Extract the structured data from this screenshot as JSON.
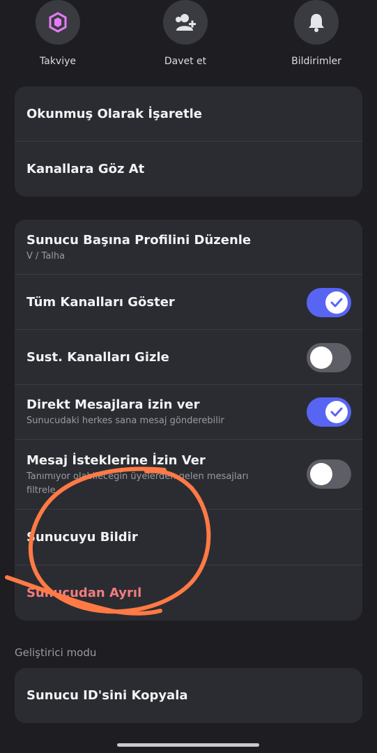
{
  "quick_actions": [
    {
      "label": "Takviye",
      "icon": "boost-icon",
      "icon_color": "#e67bf5"
    },
    {
      "label": "Davet et",
      "icon": "invite-user-icon"
    },
    {
      "label": "Bildirimler",
      "icon": "bell-icon"
    }
  ],
  "card1": {
    "mark_read": "Okunmuş Olarak İşaretle",
    "browse_channels": "Kanallara Göz At"
  },
  "card2": {
    "edit_profile": {
      "title": "Sunucu Başına Profilini Düzenle",
      "subtitle": "V / Talha"
    },
    "show_all_channels": {
      "title": "Tüm Kanalları Göster",
      "enabled": true
    },
    "hide_muted": {
      "title": "Sust. Kanalları Gizle",
      "enabled": false
    },
    "allow_dms": {
      "title": "Direkt Mesajlara izin ver",
      "subtitle": "Sunucudaki herkes sana mesaj gönderebilir",
      "enabled": true
    },
    "message_requests": {
      "title": "Mesaj İsteklerine İzin Ver",
      "subtitle": "Tanımıyor olabileceğin üyelerden gelen mesajları filtrele",
      "enabled": false
    },
    "report_server": {
      "title": "Sunucuyu Bildir"
    },
    "leave_server": {
      "title": "Sunucudan Ayrıl",
      "color": "#f27c80"
    }
  },
  "developer": {
    "section_label": "Geliştirici modu",
    "copy_id": "Sunucu ID'sini Kopyala"
  },
  "colors": {
    "background": "#1d1d22",
    "card": "#2b2c31",
    "accent": "#5865f2",
    "annotation": "#ff7a45"
  }
}
